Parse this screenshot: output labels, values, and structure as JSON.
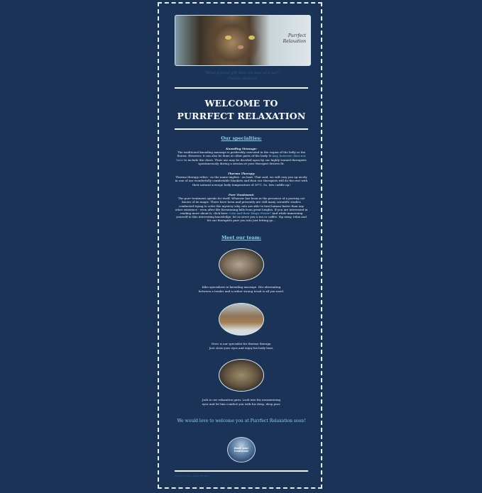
{
  "banner": {
    "brand_line1": "Purrfect",
    "brand_line2": "Relaxation"
  },
  "quote": {
    "text": "\"What greater gift than the love of a cat?\"",
    "author": "Charles Dickens"
  },
  "welcome": {
    "line1": "WELCOME TO",
    "line2": "PURRFECT RELAXATION"
  },
  "specialties": {
    "heading": "Our specialties:",
    "items": [
      {
        "title": "Kneading Massage:",
        "text_before": "The traditional kneading massage is preferably executed in the region of the belly or the thorax. However, it can also be done at other parts of the body. It ",
        "link": "may, however, does not have",
        "text_after": " to include the claws. Their use may be decided upon by our highly trained therapists spontaneously during a session at your therapist desires fit."
      },
      {
        "title": "Thermo Therapy:",
        "text_before": "Thermo therapy relies - as the name implies - on heat. That said, we will cozy you up nicely in one of our wonderfully comfortable blankets and then our therapists will do the rest with their natural average body temperature of 39°C. So, lets cuddle up!",
        "link": "",
        "text_after": ""
      },
      {
        "title": "Purr Treatment:",
        "text_before": "The purr treatment speaks for itself. Whoever has been in the presence of a purring cat knows of its magic. There have been and presently are still many scientific studies conducted trying to solve the mystery why cats are able to heal human faster than any other existence - even after life threatening falls from great heights. If you are interested in reading more about it, click here: ",
        "link": "Cats and their Magic Power?",
        "text_after": " And while immersing yourself in this interesting knowledge, let us serve you a tea or coffee. Sip away, relax and let our therapists purr you into just letting go..."
      }
    ]
  },
  "team": {
    "heading": "Meet our team:",
    "members": [
      {
        "line1": "Kiko specializes in kneading massage. Her alternating",
        "line2": "between a tender and a rather strong tread is all you need."
      },
      {
        "line1": "Nero is our specialist for thermo therapy.",
        "line2": "Just close your eyes and enjoy his body heat."
      },
      {
        "line1": "Jack is our relaxation guru. Look into his mesmerizing",
        "line2": "eyes and let him comfort you with his deep, deep purr."
      }
    ]
  },
  "closing": "We would love to welcome you at Purrfect Relaxation soon!",
  "book_button": {
    "line1": "Book your",
    "line2": "treatment"
  },
  "footer": "Design: Purrfect Ideas / Pixabay"
}
